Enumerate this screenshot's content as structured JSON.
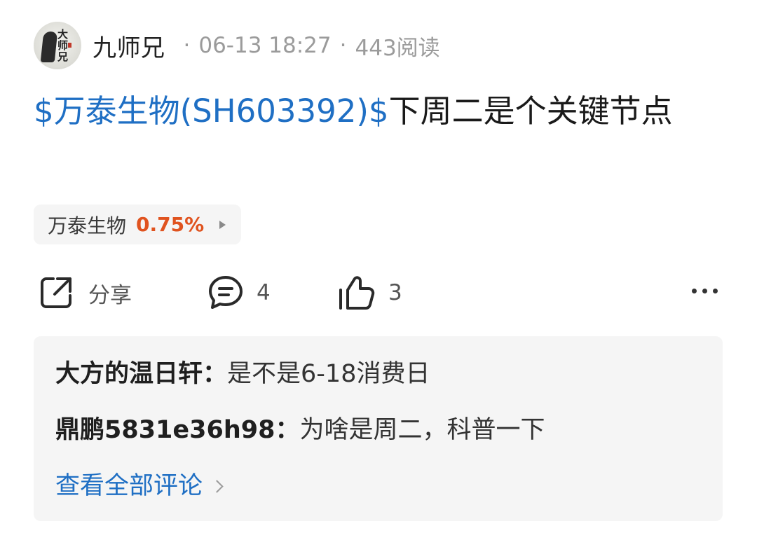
{
  "post": {
    "author": "九师兄",
    "avatar_text": "大师兄",
    "date": "06-13 18:27",
    "reads": "443阅读",
    "title_tag": "$万泰生物(SH603392)$",
    "title_text": "下周二是个关键节点"
  },
  "stock_chip": {
    "name": "万泰生物",
    "change": "0.75%",
    "change_color": "#e0531f"
  },
  "actions": {
    "share_label": "分享",
    "comment_count": "4",
    "like_count": "3",
    "icons": [
      "share-icon",
      "comment-icon",
      "thumbs-up-icon",
      "more-icon"
    ]
  },
  "comments": {
    "items": [
      {
        "user": "大方的温日轩",
        "text": "是不是6-18消费日"
      },
      {
        "user": "鼎鹏5831e36h98",
        "text": "为啥是周二，科普一下"
      }
    ],
    "view_all": "查看全部评论"
  },
  "colors": {
    "link_blue": "#1f6fc4",
    "muted_gray": "#9b9b9b",
    "panel_bg": "#f5f5f5"
  }
}
